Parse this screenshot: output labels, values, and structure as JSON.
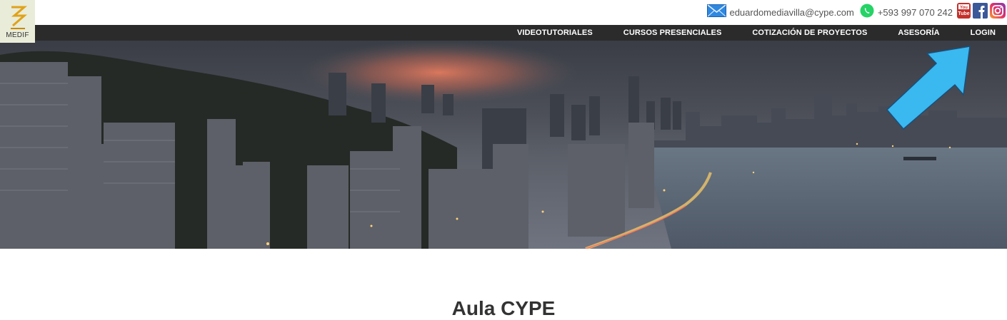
{
  "brand": {
    "logo_text": "MEDIF"
  },
  "contact": {
    "email": "eduardomediavilla@cype.com",
    "phone": "+593 997 070 242",
    "email_icon": "envelope-icon",
    "phone_icon": "whatsapp-icon"
  },
  "social": {
    "youtube_label": "You Tube",
    "youtube_icon": "youtube-icon",
    "facebook_icon": "facebook-icon",
    "instagram_icon": "instagram-icon"
  },
  "nav": {
    "items": [
      {
        "label": "VIDEOTUTORIALES"
      },
      {
        "label": "CURSOS PRESENCIALES"
      },
      {
        "label": "COTIZACIÓN DE PROYECTOS"
      },
      {
        "label": "ASESORÍA"
      },
      {
        "label": "LOGIN"
      }
    ]
  },
  "hero": {
    "image": "city-skyline-at-dusk",
    "annotation": "arrow-pointing-to-login"
  },
  "main": {
    "title": "Aula CYPE"
  },
  "colors": {
    "nav_bg": "#2b2b2b",
    "nav_text": "#ffffff",
    "arrow": "#3ab8f0",
    "title": "#333333"
  }
}
